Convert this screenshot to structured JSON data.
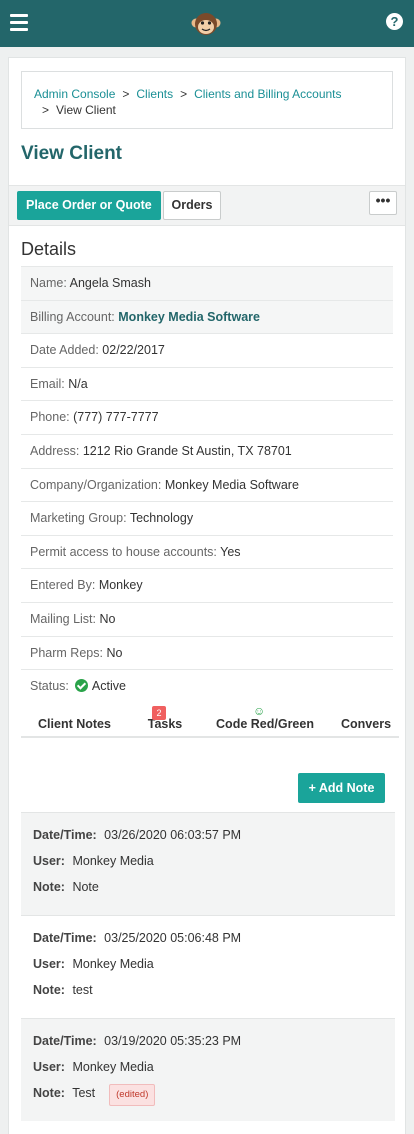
{
  "breadcrumbs": [
    "Admin Console",
    "Clients",
    "Clients and Billing Accounts",
    "View Client"
  ],
  "page_title": "View Client",
  "actions": {
    "place_order": "Place Order or Quote",
    "orders": "Orders",
    "more": "•••"
  },
  "details_title": "Details",
  "details": [
    {
      "label": "Name:",
      "value": "Angela Smash"
    },
    {
      "label": "Billing Account:",
      "value": "Monkey Media Software"
    },
    {
      "label": "Date Added:",
      "value": "02/22/2017"
    },
    {
      "label": "Email:",
      "value": "N/a"
    },
    {
      "label": "Phone:",
      "value": "(777) 777-7777"
    },
    {
      "label": "Address:",
      "value": "1212 Rio Grande St Austin, TX 78701"
    },
    {
      "label": "Company/Organization:",
      "value": "Monkey Media Software"
    },
    {
      "label": "Marketing Group:",
      "value": "Technology"
    },
    {
      "label": "Permit access to house accounts:",
      "value": "Yes"
    },
    {
      "label": "Entered By:",
      "value": "Monkey"
    },
    {
      "label": "Mailing List:",
      "value": "No"
    },
    {
      "label": "Pharm Reps:",
      "value": "No"
    },
    {
      "label": "Status:",
      "value": "Active"
    }
  ],
  "tabs": [
    {
      "label": "Client Notes",
      "active": true
    },
    {
      "label": "Tasks",
      "badge": "2"
    },
    {
      "label": "Code Red/Green",
      "icon": "smiley-icon"
    },
    {
      "label": "Convers"
    }
  ],
  "add_note": "+ Add Note",
  "note_keys": {
    "datetime": "Date/Time:",
    "user": "User:",
    "note": "Note:"
  },
  "notes": [
    {
      "datetime": "03/26/2020 06:03:57 PM",
      "user": "Monkey Media",
      "note": "Note"
    },
    {
      "datetime": "03/25/2020 05:06:48 PM",
      "user": "Monkey Media",
      "note": "test"
    },
    {
      "datetime": "03/19/2020 05:35:23 PM",
      "user": "Monkey Media",
      "note": "Test",
      "edited": "(edited)"
    }
  ],
  "colors": {
    "header": "#23666a",
    "accent": "#1aa49a",
    "status_green": "#2aa34a",
    "badge": "#f06060"
  }
}
